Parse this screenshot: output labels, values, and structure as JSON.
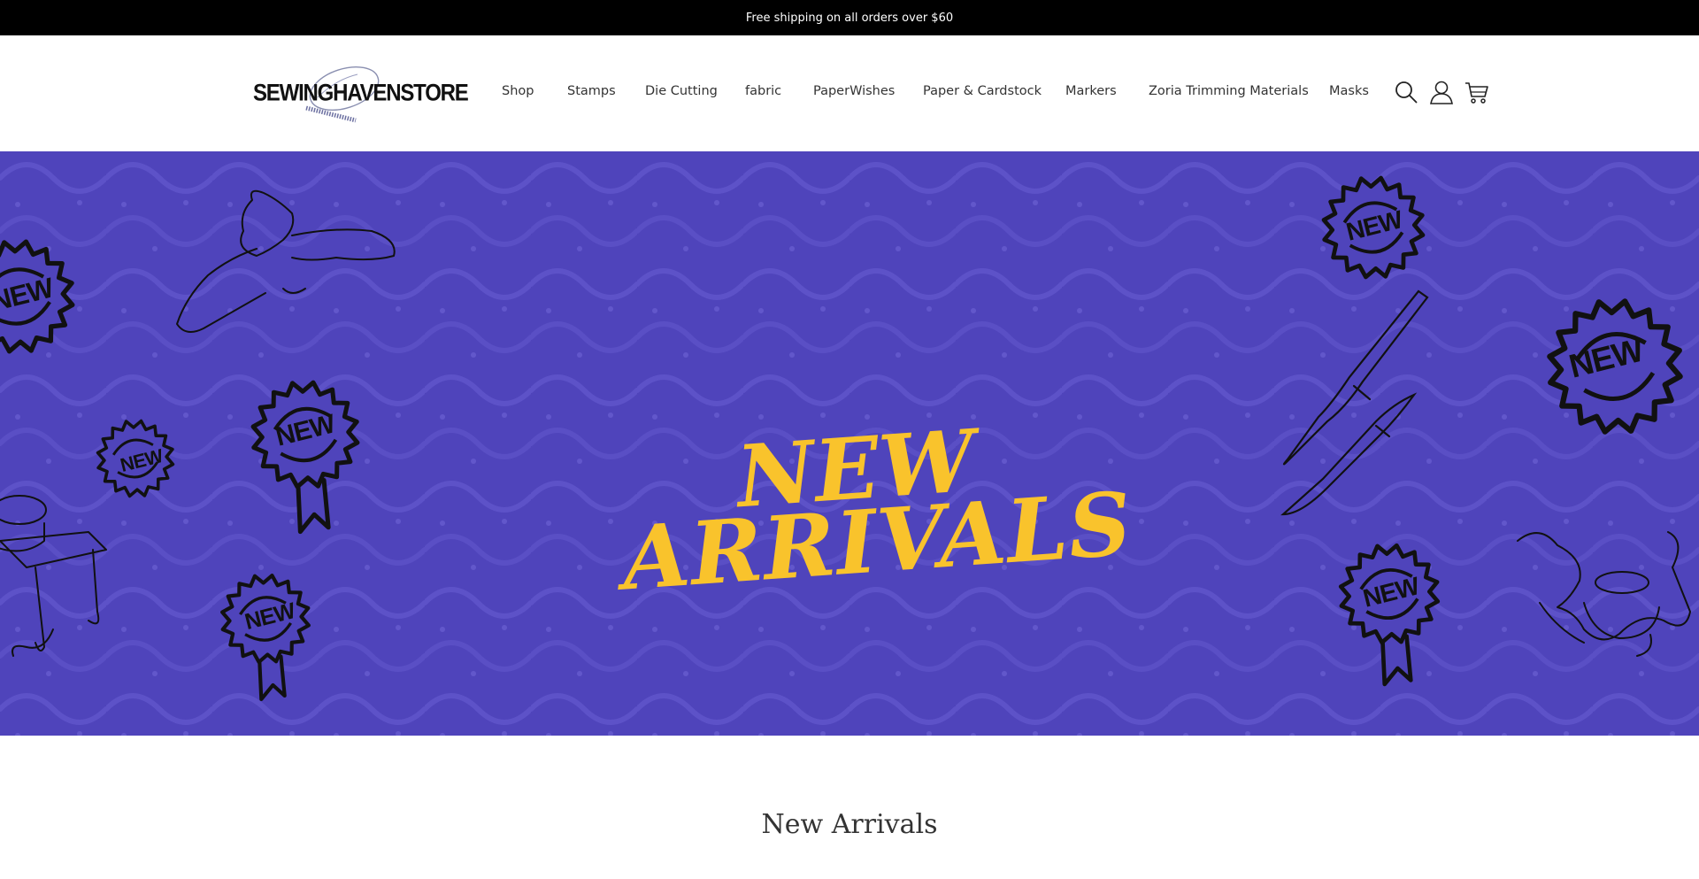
{
  "announcement": {
    "text": "Free shipping on all orders over $60"
  },
  "header": {
    "logo_text": "SEWINGHAVENSTORE",
    "nav": [
      {
        "label": "Shop"
      },
      {
        "label": "Stamps"
      },
      {
        "label": "Die Cutting"
      },
      {
        "label": "fabric"
      },
      {
        "label": "PaperWishes"
      },
      {
        "label": "Paper & Cardstock"
      },
      {
        "label": "Markers"
      },
      {
        "label": "Zoria Trimming Materials"
      },
      {
        "label": "Masks"
      }
    ],
    "icons": [
      "search-icon",
      "account-icon",
      "cart-icon"
    ]
  },
  "hero": {
    "title_line1": "NEW",
    "title_line2": "ARRIVALS",
    "badge_text": "NEW",
    "background_color": "#4f44bb",
    "title_color": "#f9c32c"
  },
  "section": {
    "title": "New Arrivals"
  }
}
